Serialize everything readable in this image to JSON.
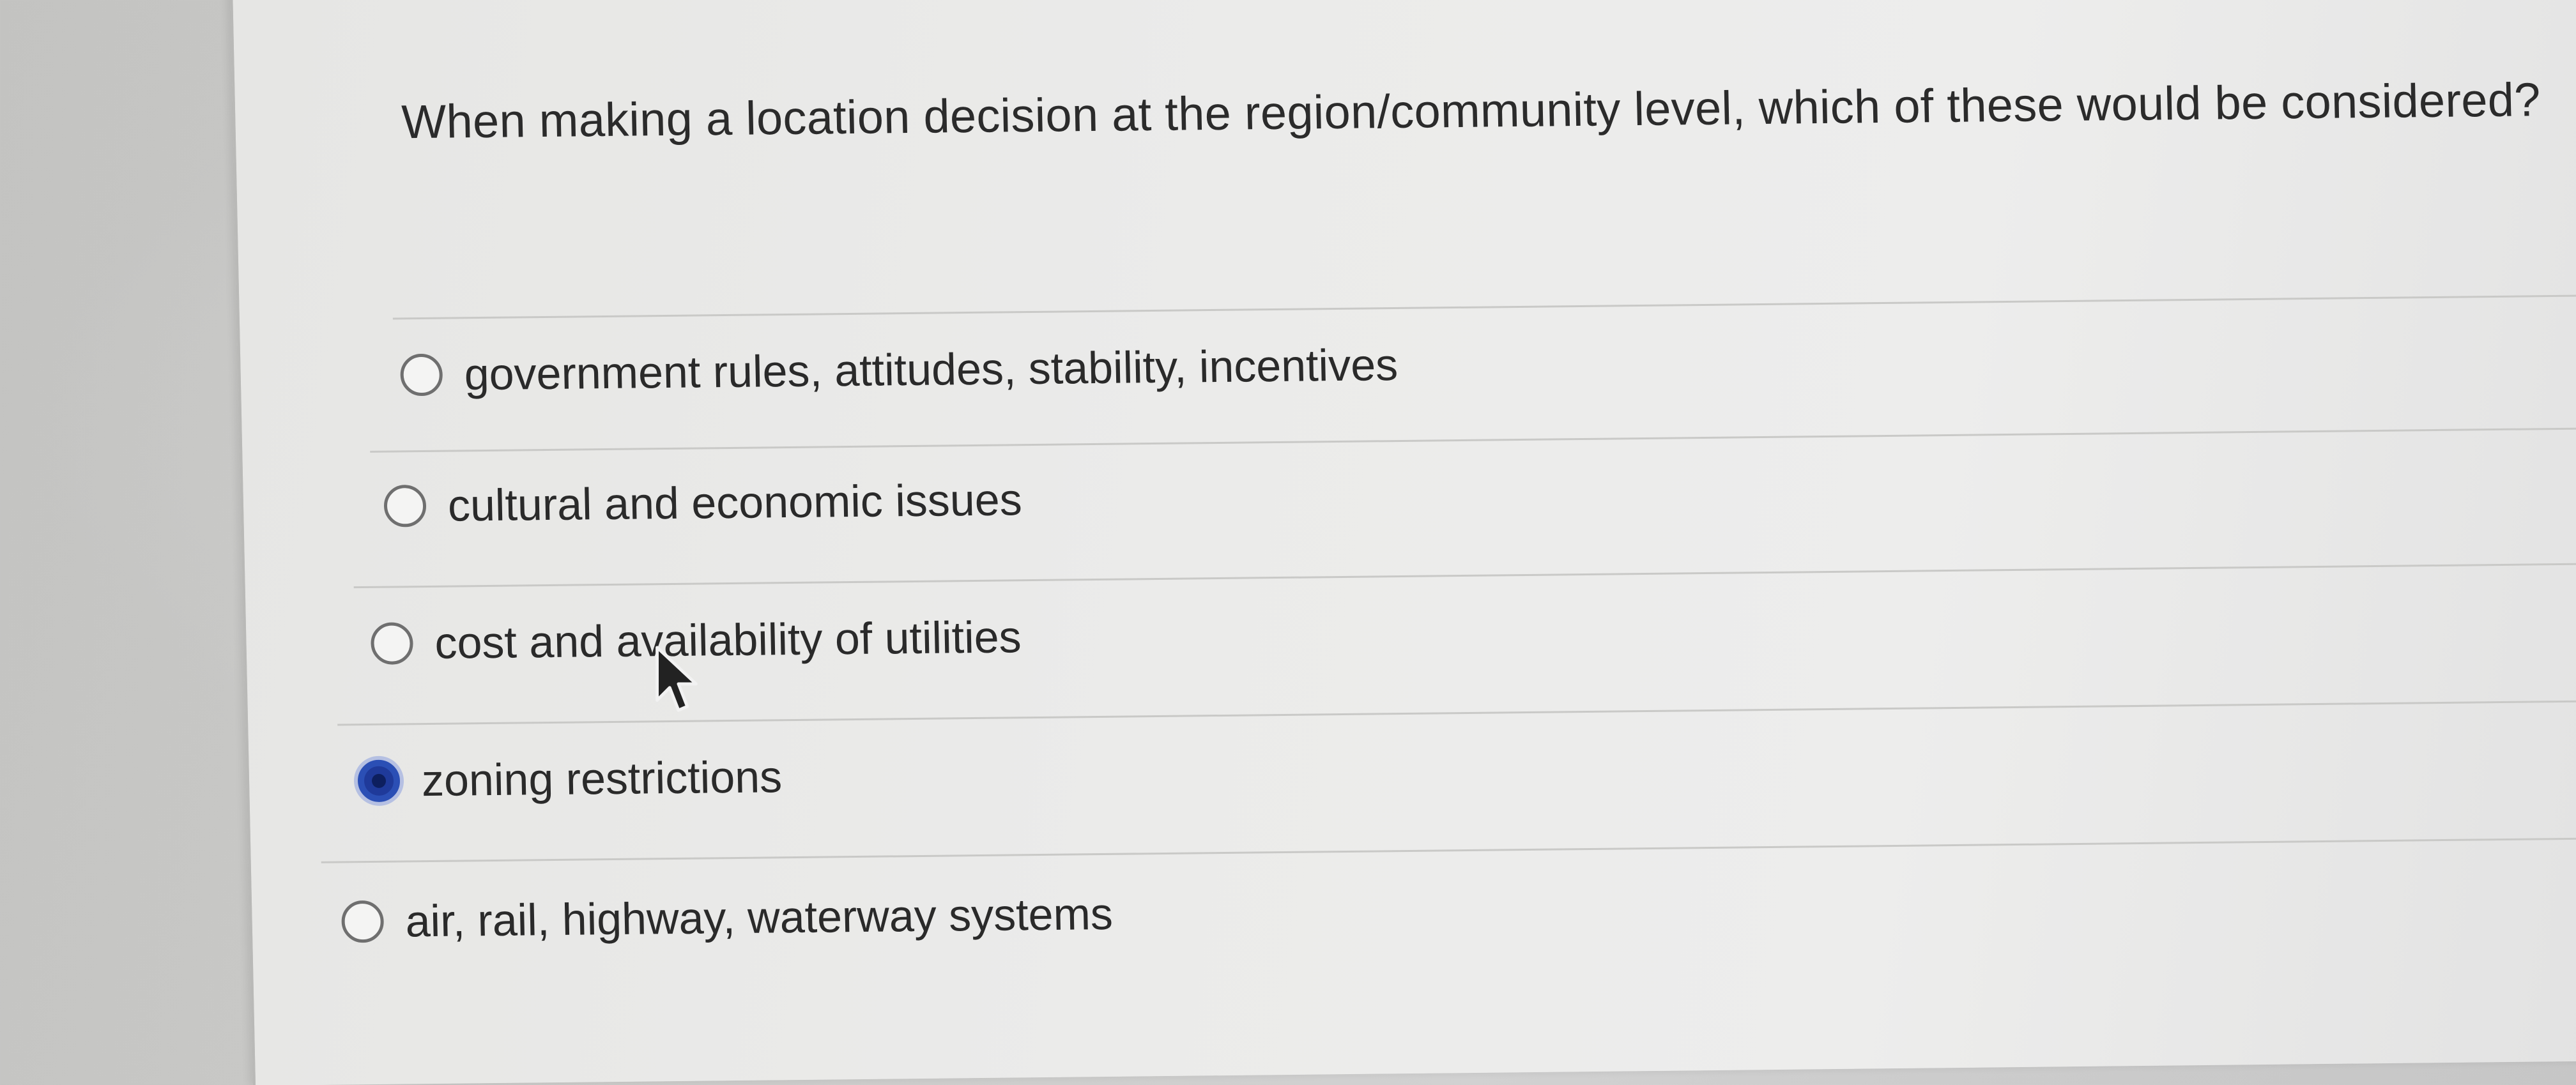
{
  "question": {
    "text": "When making a location decision at the region/community level, which of these would be considered?"
  },
  "options": [
    {
      "label": "government rules, attitudes, stability, incentives",
      "selected": false
    },
    {
      "label": "cultural and economic issues",
      "selected": false
    },
    {
      "label": "cost and availability of utilities",
      "selected": false
    },
    {
      "label": "zoning restrictions",
      "selected": true
    },
    {
      "label": "air, rail, highway, waterway systems",
      "selected": false
    }
  ],
  "colors": {
    "selected_radio": "#2b4fb5",
    "text": "#2a2a2a"
  },
  "icons": {
    "cursor": "mouse-pointer-icon"
  }
}
